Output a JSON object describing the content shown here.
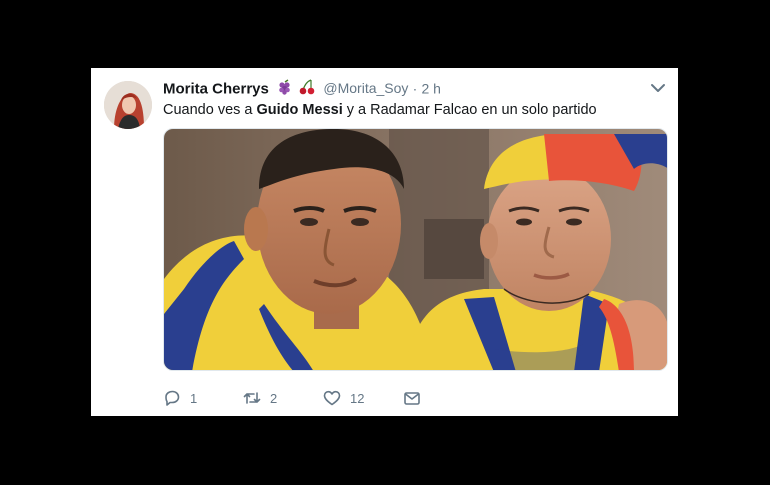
{
  "tweet": {
    "author_name": "Morita Cherrys",
    "handle": "@Morita_Soy",
    "separator": "·",
    "time": "2 h",
    "text_prefix": "Cuando ves a ",
    "text_bold": "Guido Messi",
    "text_suffix": " y a Radamar Falcao en un solo partido",
    "emojis": [
      "grapes-emoji",
      "cherries-emoji"
    ]
  },
  "actions": {
    "reply_count": "1",
    "retweet_count": "2",
    "like_count": "12"
  },
  "colors": {
    "background": "#000000",
    "card": "#ffffff",
    "text": "#14171a",
    "secondary": "#657786",
    "jersey_yellow": "#f2d13a",
    "jersey_blue": "#2a3f8f",
    "hat_red": "#e8543a"
  }
}
